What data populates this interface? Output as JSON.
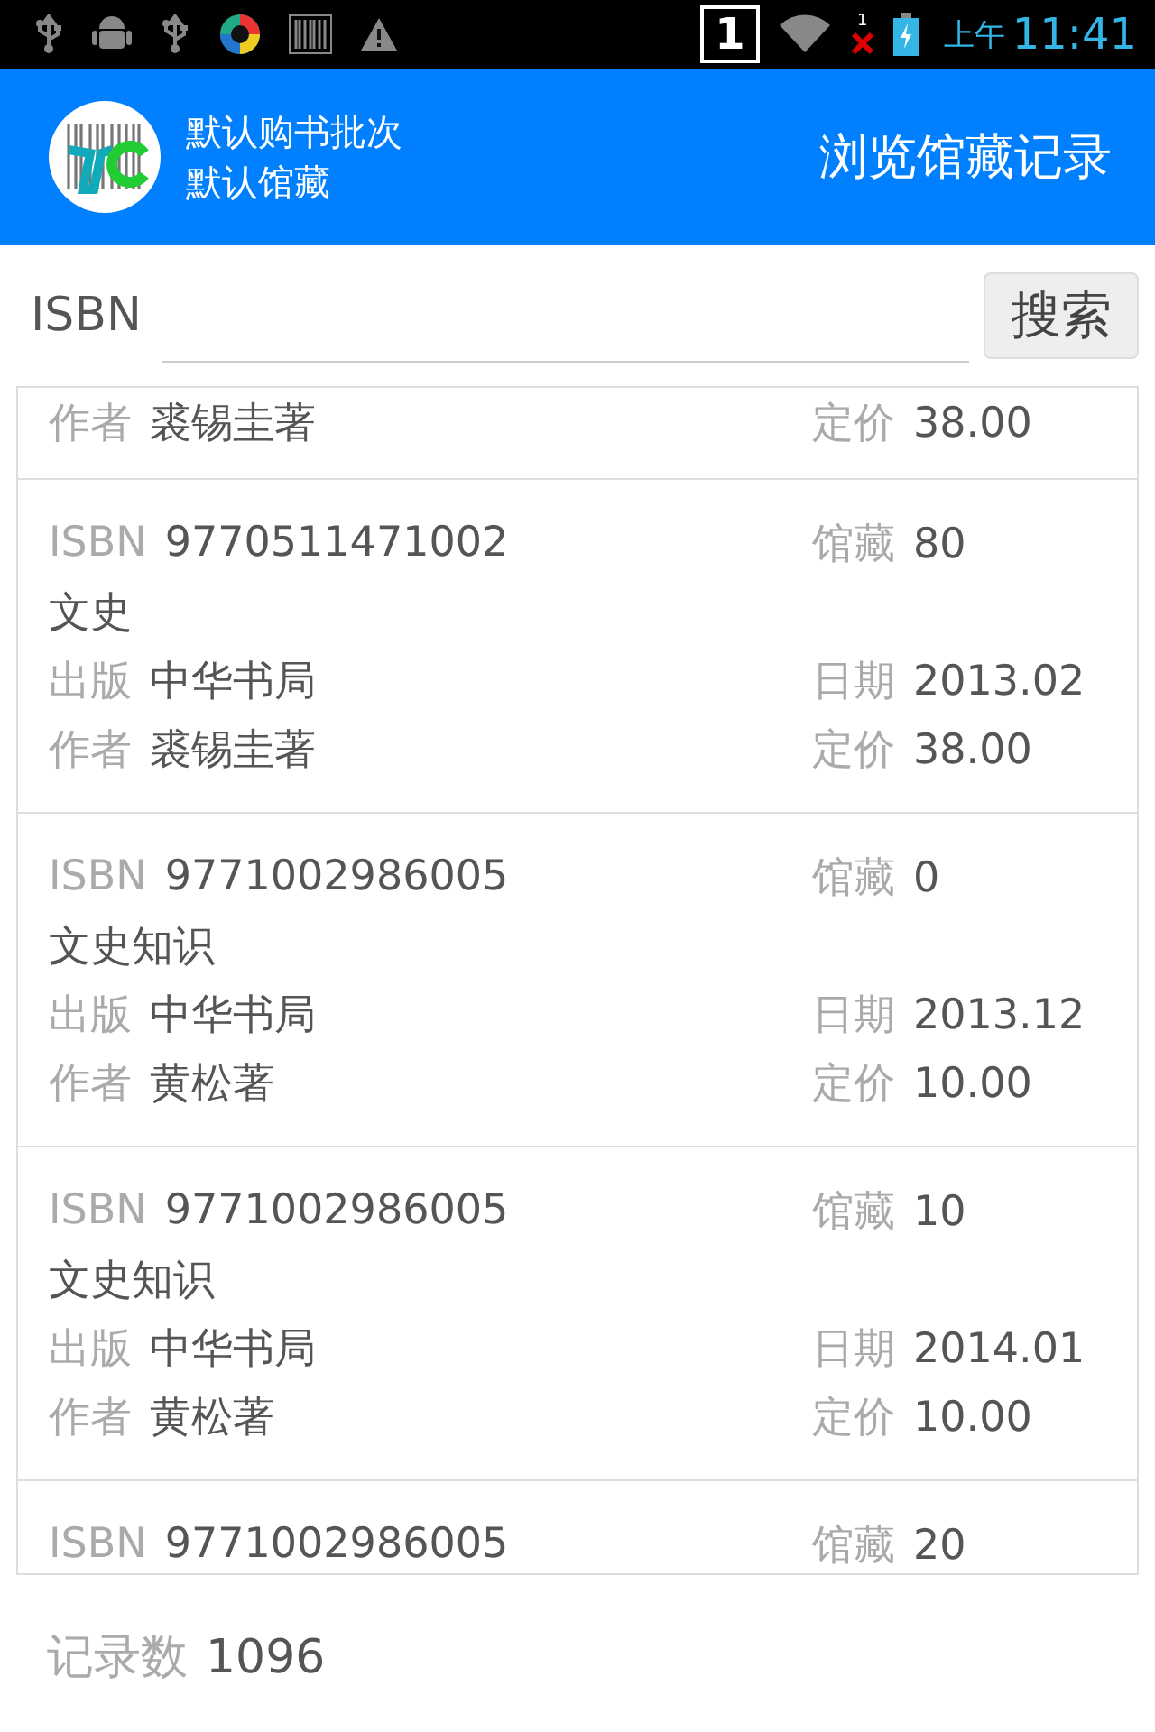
{
  "status_bar": {
    "sim_badge": "1",
    "signal_count": "1",
    "am_pm": "上午",
    "time": "11:41"
  },
  "header": {
    "batch": "默认购书批次",
    "collection": "默认馆藏",
    "title": "浏览馆藏记录"
  },
  "search": {
    "label": "ISBN",
    "button": "搜索"
  },
  "records": [
    {
      "lines": [
        {
          "left": {
            "label": "作者",
            "value": "裘锡圭著"
          },
          "right": {
            "label": "定价",
            "value": "38.00"
          }
        }
      ]
    },
    {
      "lines": [
        {
          "left": {
            "label": "ISBN",
            "value": "9770511471002"
          },
          "right": {
            "label": "馆藏",
            "value": "80"
          }
        },
        {
          "left": {
            "value": "文史"
          }
        },
        {
          "left": {
            "label": "出版",
            "value": "中华书局"
          },
          "right": {
            "label": "日期",
            "value": "2013.02"
          }
        },
        {
          "left": {
            "label": "作者",
            "value": "裘锡圭著"
          },
          "right": {
            "label": "定价",
            "value": "38.00"
          }
        }
      ]
    },
    {
      "lines": [
        {
          "left": {
            "label": "ISBN",
            "value": "9771002986005"
          },
          "right": {
            "label": "馆藏",
            "value": "0"
          }
        },
        {
          "left": {
            "value": "文史知识"
          }
        },
        {
          "left": {
            "label": "出版",
            "value": "中华书局"
          },
          "right": {
            "label": "日期",
            "value": "2013.12"
          }
        },
        {
          "left": {
            "label": "作者",
            "value": "黄松著"
          },
          "right": {
            "label": "定价",
            "value": "10.00"
          }
        }
      ]
    },
    {
      "lines": [
        {
          "left": {
            "label": "ISBN",
            "value": "9771002986005"
          },
          "right": {
            "label": "馆藏",
            "value": "10"
          }
        },
        {
          "left": {
            "value": "文史知识"
          }
        },
        {
          "left": {
            "label": "出版",
            "value": "中华书局"
          },
          "right": {
            "label": "日期",
            "value": "2014.01"
          }
        },
        {
          "left": {
            "label": "作者",
            "value": "黄松著"
          },
          "right": {
            "label": "定价",
            "value": "10.00"
          }
        }
      ]
    },
    {
      "lines": [
        {
          "left": {
            "label": "ISBN",
            "value": "9771002986005"
          },
          "right": {
            "label": "馆藏",
            "value": "20"
          }
        }
      ]
    }
  ],
  "footer": {
    "label": "记录数",
    "value": "1096"
  }
}
